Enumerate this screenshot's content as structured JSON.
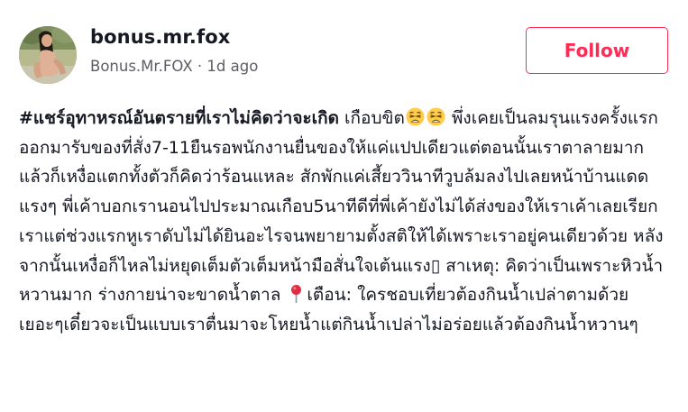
{
  "author": {
    "username": "bonus.mr.fox",
    "display_name": "Bonus.Mr.FOX",
    "separator": " · ",
    "posted_ago": "1d ago"
  },
  "actions": {
    "follow_label": "Follow"
  },
  "caption": {
    "hashtag": "#แชร์อุทาหรณ์อันตรายที่เราไม่คิดว่าจะเกิด",
    "part_1": " เกือบขิต",
    "emoji_1": "weary-face",
    "emoji_2": "weary-face",
    "part_2": " พึ่งเคยเป็นลมรุนแรงครั้งแรก ออกมารับของที่สั่ง7-11ยืนรอพนักงานยื่นของให้แค่แปปเดียวแต่ตอนนั้นเราตาลายมากแล้วก็เหงื่อแตกทั้งตัวก็คิดว่าร้อนแหละ สักพักแค่เสี้ยววินาทีวูบล้มลงไปเลยหน้าบ้านแดดแรงๆ พี่เค้าบอกเรานอนไปประมาณเกือบ5นาทีดีที่พี่เค้ายังไม่ได้ส่งของให้เราเค้าเลยเรียกเราแต่ช่วงแรกหูเราดับไม่ได้ยินอะไรจนพยายามตั้งสติให้ได้เพราะเราอยู่คนเดียวด้วย หลังจากนั้นเหงื่อก็ไหลไม่หยุดเต็มตัวเต็มหน้ามือสั่นใจเต้นแรง",
    "glyph_placeholder": "▯",
    "part_3": " สาเหตุ: คิดว่าเป็นเพราะหิวน้ำหวานมาก ร่างกายน่าจะขาดน้ำตาล ",
    "emoji_3": "round-pushpin",
    "part_4": "เตือน: ใครชอบเที่ยวต้องกินน้ำเปล่าตามด้วยเยอะๆเดี๋ยวจะเป็นแบบเราตื่นมาจะโหยน้ำแต่กินน้ำเปล่าไม่อร่อยแล้วต้องกินน้ำหวานๆ"
  },
  "colors": {
    "accent": "#fe2c55",
    "text": "#161823",
    "secondary_text": "#5c5d63"
  }
}
